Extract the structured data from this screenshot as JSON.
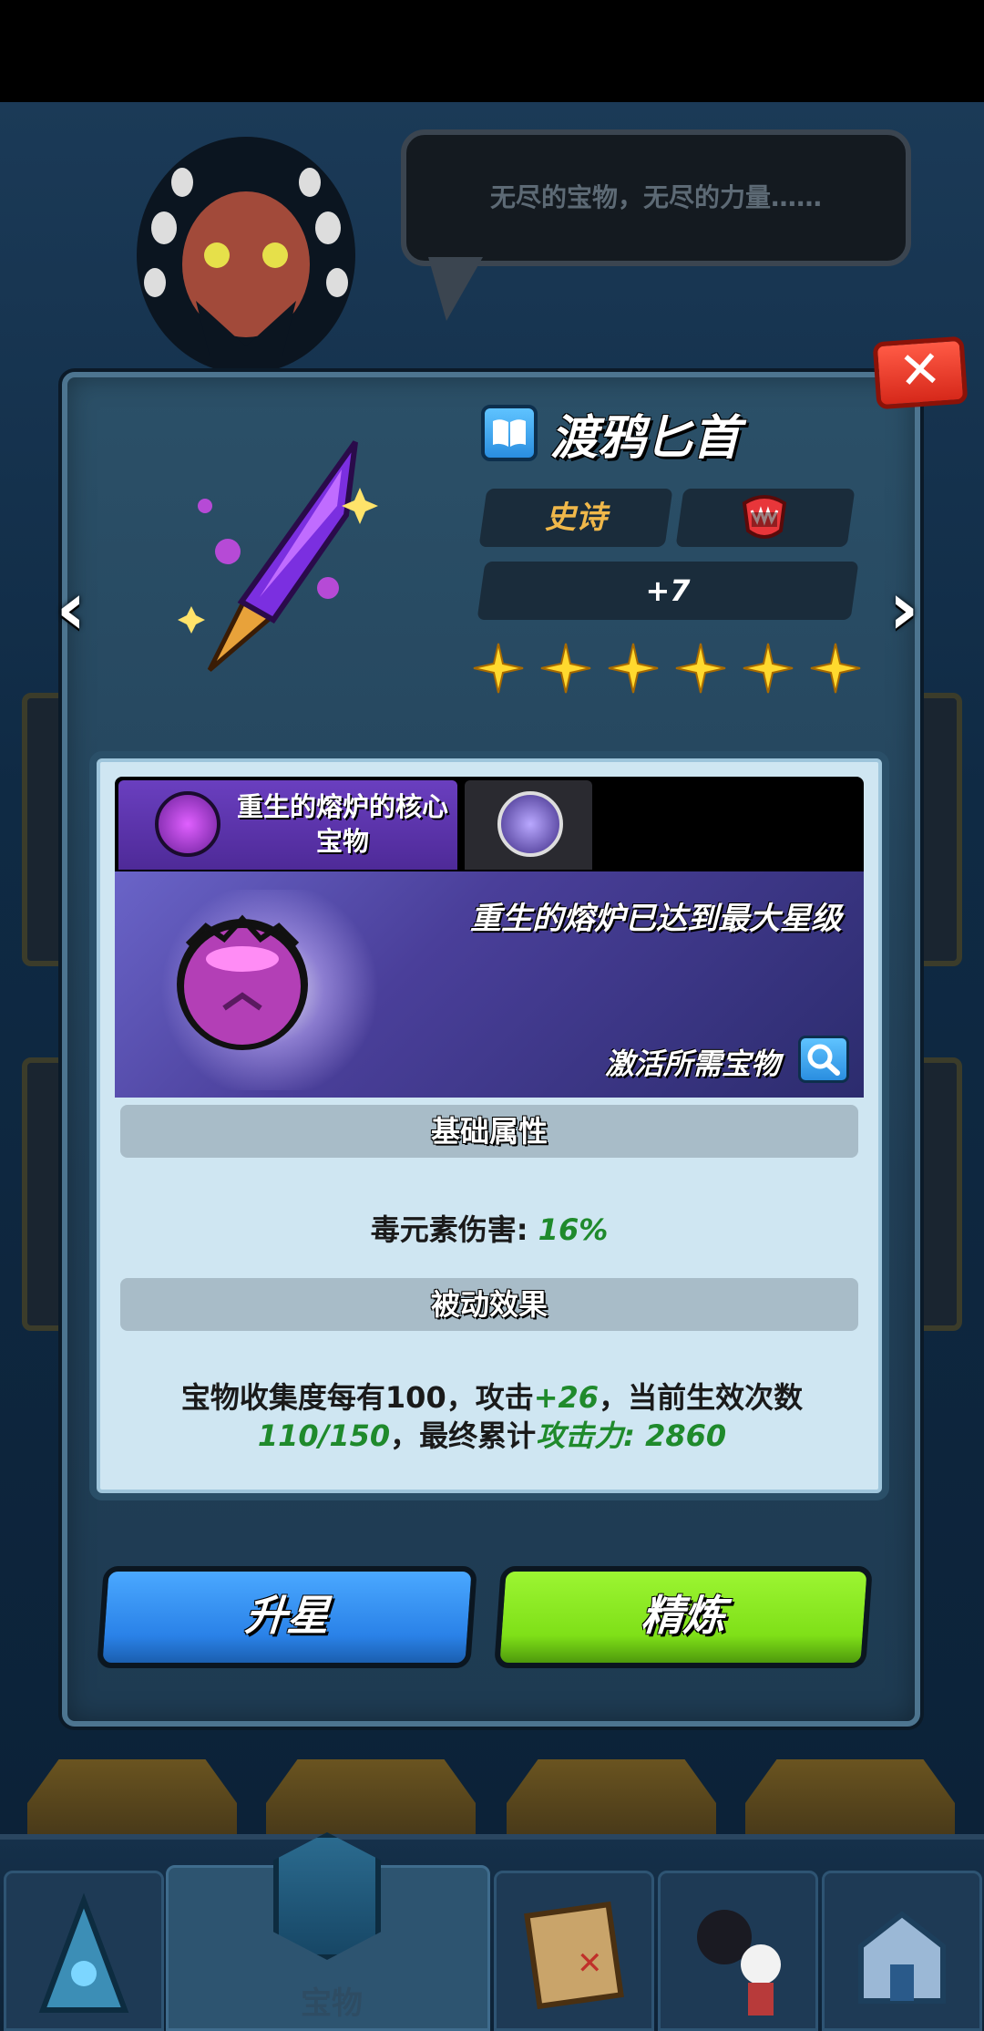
{
  "speech": {
    "text": "无尽的宝物，无尽的力量……"
  },
  "item": {
    "name": "渡鸦匕首",
    "rarity": "史诗",
    "level": "+7",
    "stars": 6
  },
  "set": {
    "tab_label": "重生的熔炉的核心宝物",
    "banner_title": "重生的熔炉已达到最大星级",
    "activate_label": "激活所需宝物"
  },
  "base_attr": {
    "header": "基础属性",
    "stat_label": "毒元素伤害: ",
    "stat_value": "16%"
  },
  "passive": {
    "header": "被动效果",
    "part1": "宝物收集度每有100，攻击",
    "part2": "+26",
    "part3": "，当前生效次数",
    "part4": "110/150",
    "part5": "，最终累计",
    "part6": "攻击力: 2860"
  },
  "buttons": {
    "star_up": "升星",
    "refine": "精炼"
  },
  "nav": {
    "active_label": "宝物"
  },
  "colors": {
    "rarity": "#f0b84a",
    "highlight": "#1f8a2c",
    "star_btn": "#2a82e8",
    "refine_btn": "#7fe018"
  }
}
